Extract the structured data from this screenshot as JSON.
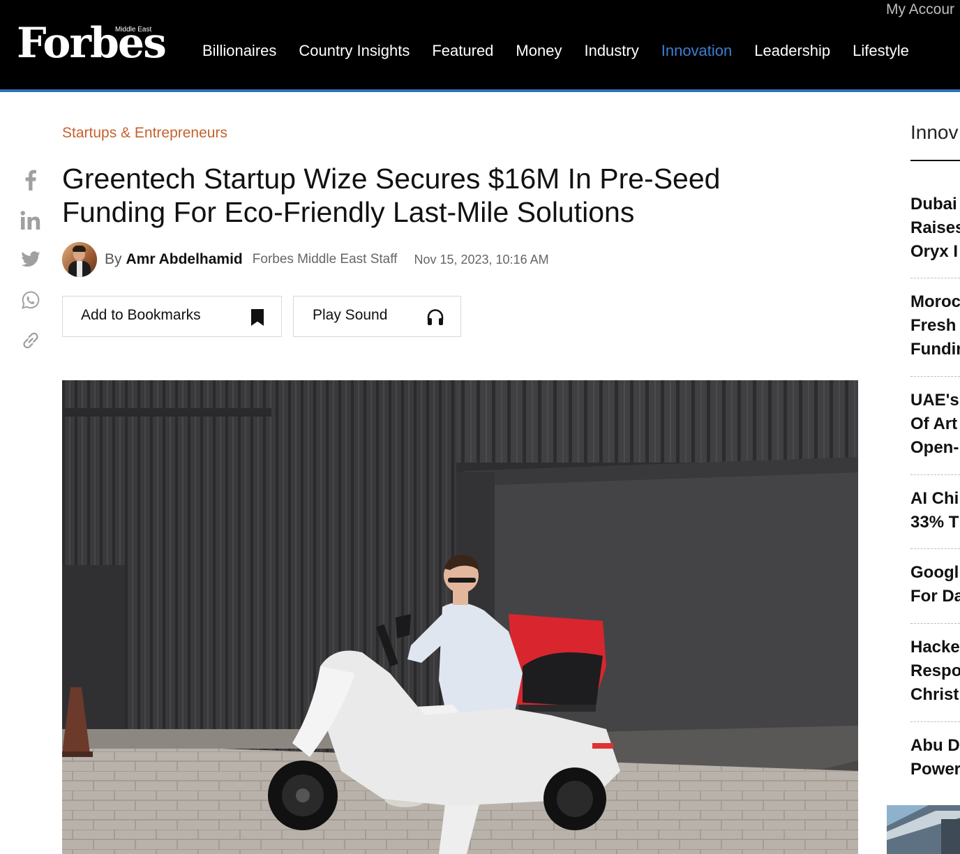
{
  "header": {
    "logo": {
      "word": "Forbes",
      "sub": "Middle East"
    },
    "account_link": "My Accour",
    "nav": [
      {
        "label": "Billionaires",
        "active": false
      },
      {
        "label": "Country Insights",
        "active": false
      },
      {
        "label": "Featured",
        "active": false
      },
      {
        "label": "Money",
        "active": false
      },
      {
        "label": "Industry",
        "active": false
      },
      {
        "label": "Innovation",
        "active": true
      },
      {
        "label": "Leadership",
        "active": false
      },
      {
        "label": "Lifestyle",
        "active": false
      }
    ]
  },
  "social": [
    {
      "icon": "facebook-icon"
    },
    {
      "icon": "linkedin-icon"
    },
    {
      "icon": "twitter-icon"
    },
    {
      "icon": "whatsapp-icon"
    },
    {
      "icon": "link-icon"
    }
  ],
  "article": {
    "category": "Startups & Entrepreneurs",
    "title": "Greentech Startup Wize Secures $16M In Pre-Seed Funding For Eco-Friendly Last-Mile Solutions",
    "byline": {
      "prefix": "By",
      "author": "Amr Abdelhamid",
      "role": "Forbes Middle East Staff",
      "date": "Nov 15, 2023, 10:16 AM"
    },
    "actions": {
      "bookmark_label": "Add to Bookmarks",
      "bookmark_icon": "bookmark-icon",
      "sound_label": "Play Sound",
      "sound_icon": "headphones-icon"
    }
  },
  "sidebar": {
    "heading": "Innov",
    "items": [
      {
        "lines": [
          "Dubai",
          "Raises",
          "Oryx I"
        ]
      },
      {
        "lines": [
          "Moroc",
          "Fresh",
          "Fundir"
        ]
      },
      {
        "lines": [
          "UAE's",
          "Of Art",
          "Open-"
        ]
      },
      {
        "lines": [
          "AI Chi",
          "33% T"
        ]
      },
      {
        "lines": [
          "Googl",
          "For Da"
        ]
      },
      {
        "lines": [
          "Hacke",
          "Respo",
          "Christ"
        ]
      },
      {
        "lines": [
          "Abu D",
          "Power"
        ]
      }
    ]
  },
  "colors": {
    "header_bg": "#000000",
    "accent_blue": "#3d7fd1",
    "category_orange": "#c4622d",
    "rule_blue": "#2f6fb6"
  }
}
